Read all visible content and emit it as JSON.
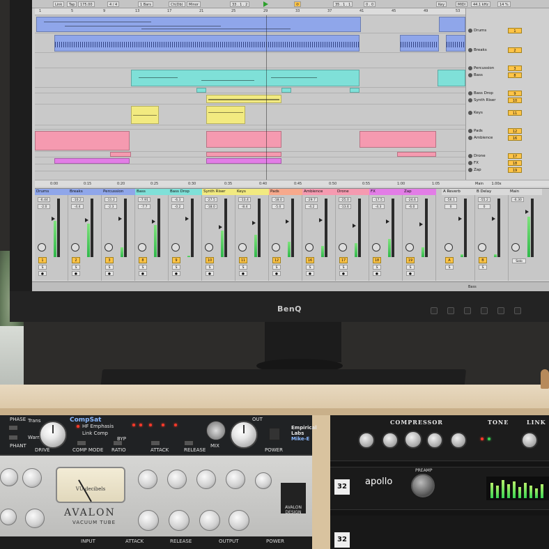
{
  "transport": {
    "link": "Link",
    "tap": "Tap",
    "tempo": "175.00",
    "signature": "4 / 4",
    "quantize": "1 Bars",
    "key_root": "Ch(Db)",
    "key_scale": "Minor",
    "position": "33 . 1 . 2",
    "loop_start": "35 . 1 . 1",
    "loop_length": "0 . 0",
    "key_label": "Key",
    "midi_label": "MIDI",
    "sample_rate": "44.1 kHz",
    "cpu": "14 %",
    "set_label": "Set"
  },
  "ruler_marks": [
    "1",
    "5",
    "9",
    "13",
    "17",
    "21",
    "25",
    "29",
    "33",
    "37",
    "41",
    "45",
    "49",
    "53"
  ],
  "time_marks": [
    "0:00",
    "0:15",
    "0:20",
    "0:25",
    "0:30",
    "0:35",
    "0:40",
    "0:45",
    "0:50",
    "0:55",
    "1:00",
    "1:05"
  ],
  "tracks": [
    {
      "name": "Drums",
      "num": "1",
      "color": "#8fa6ea",
      "val": "-6.44",
      "pan": "-2.0"
    },
    {
      "name": "Breaks",
      "num": "2",
      "color": "#8fa6ea",
      "val": "-10.2",
      "pan": "-4.4"
    },
    {
      "name": "Percussion",
      "num": "3",
      "color": "#8fa6ea",
      "val": "-11.2",
      "pan": "-2.3"
    },
    {
      "name": "Bass",
      "num": "8",
      "color": "#7fe0d8",
      "val": "-7.91",
      "pan": "-7.7"
    },
    {
      "name": "Bass Drop",
      "num": "9",
      "color": "#7fe0d8",
      "val": "-6.3",
      "pan": "-0.2"
    },
    {
      "name": "Synth Riser",
      "num": "10",
      "color": "#f2ea80",
      "val": "-27.5",
      "pan": "-18.0"
    },
    {
      "name": "Keys",
      "num": "11",
      "color": "#f2ea80",
      "val": "-13.4",
      "pan": "-8.4"
    },
    {
      "name": "Pads",
      "num": "12",
      "color": "#f7a98c",
      "val": "-18.0",
      "pan": "-5.0"
    },
    {
      "name": "Ambience",
      "num": "16",
      "color": "#f59ab0",
      "val": "-29.7",
      "pan": "-4.2"
    },
    {
      "name": "Drone",
      "num": "17",
      "color": "#f59ab0",
      "val": "-25.0",
      "pan": "-13.6"
    },
    {
      "name": "FX",
      "num": "18",
      "color": "#e27de6",
      "val": "-17.5",
      "pan": "-4.3"
    },
    {
      "name": "Zap",
      "num": "19",
      "color": "#e27de6",
      "val": "-24.6",
      "pan": "-6.0"
    }
  ],
  "returns": [
    {
      "name": "A Reverb",
      "num": "A",
      "val": "-56.1",
      "pan": "0"
    },
    {
      "name": "B Delay",
      "num": "B",
      "val": "-55.2",
      "pan": "0"
    }
  ],
  "master": {
    "name": "Main",
    "val": "-6.30",
    "mode": "Solo"
  },
  "main_row": {
    "label": "Main",
    "value": "1.00x"
  },
  "bottom_bar": {
    "left": "Bass",
    "right": ""
  },
  "hardware": {
    "monitor_brand": "BenQ",
    "compsat_title": "CompSat",
    "compsat_labels": [
      "PHASE",
      "PHANT",
      "DRIVE",
      "COMP MODE",
      "RATIO",
      "ATTACK",
      "RELEASE",
      "MIX",
      "OUT",
      "POWER",
      "HF Emphasis",
      "Link Comp",
      "Trans",
      "Warm",
      "BYP"
    ],
    "empirical": "Empirical Labs",
    "mike_e": "Mike-E",
    "vu_text": "VU decibels",
    "avalon_name": "AVALON",
    "avalon_sub": "VACUUM TUBE",
    "avalon_design": "AVALON DESIGN",
    "strip_labels": [
      "INPUT",
      "ATTACK",
      "RELEASE",
      "OUTPUT",
      "POWER"
    ],
    "comp_unit_labels": [
      "COMPRESSOR",
      "TONE",
      "LINK"
    ],
    "apollo_logo": "apollo",
    "preamp_label": "PREAMP",
    "badge": "32"
  }
}
